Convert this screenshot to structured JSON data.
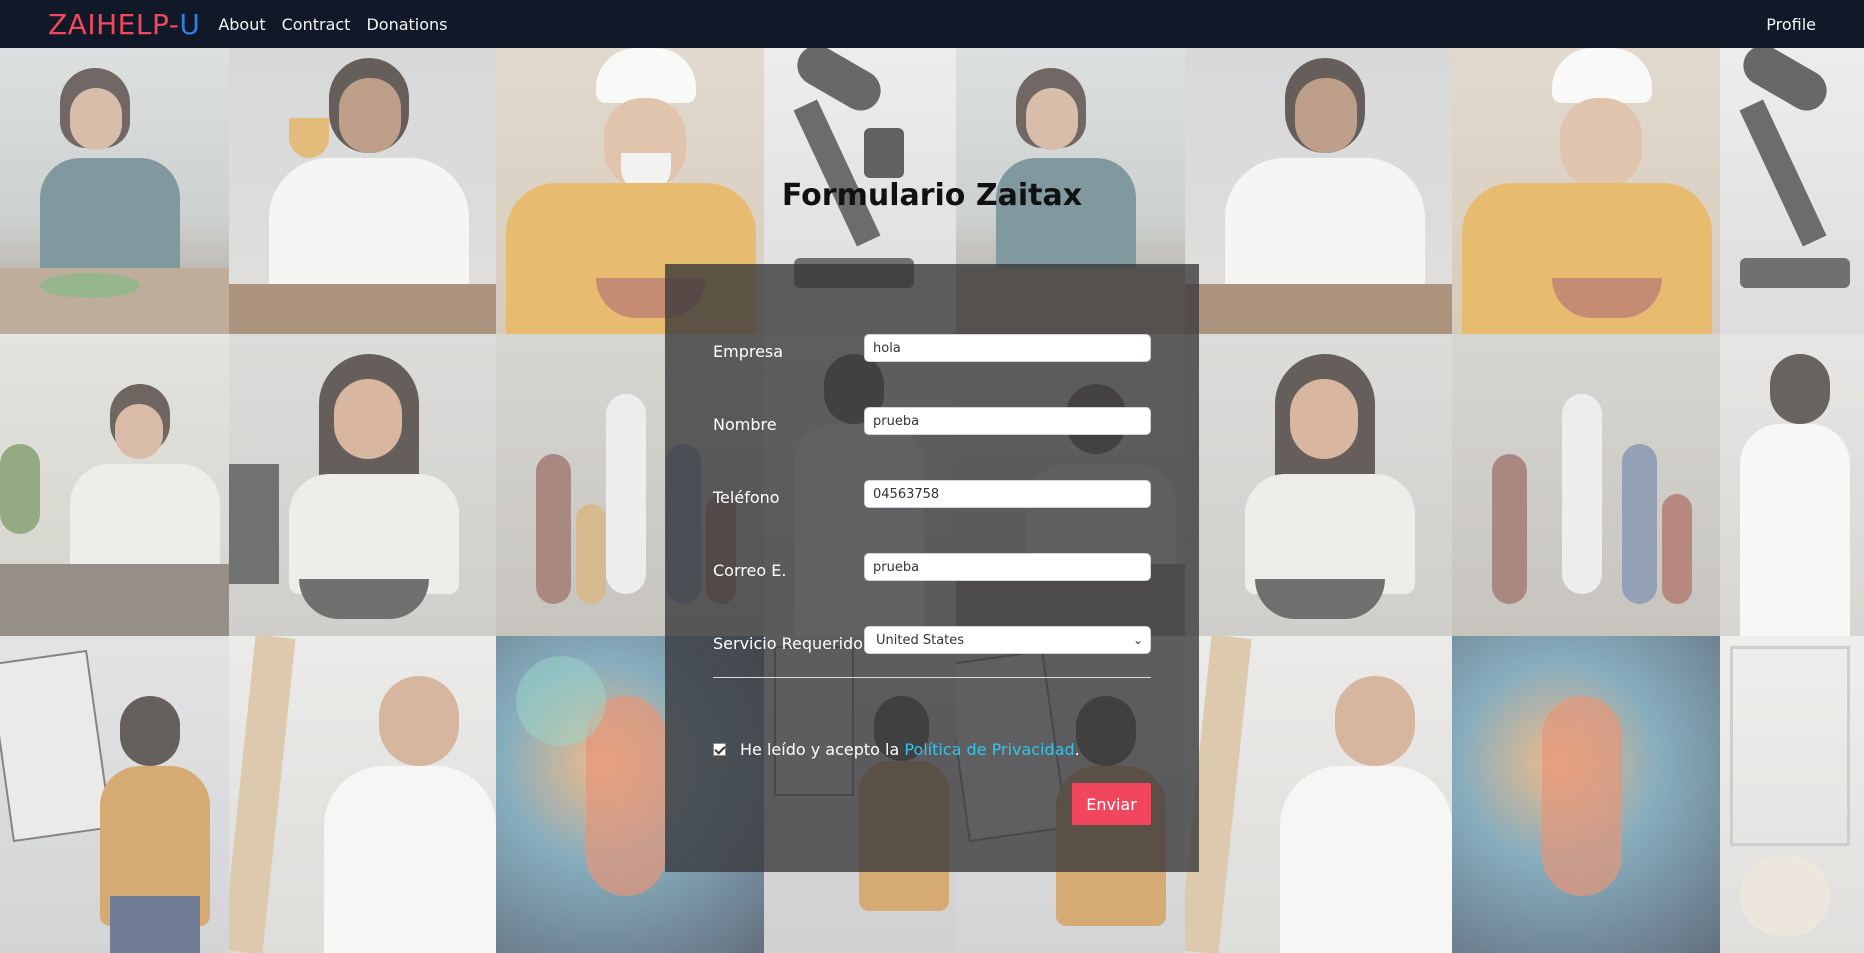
{
  "nav": {
    "brand_part1": "ZAIHELP-",
    "brand_part2": "U",
    "links": [
      "About",
      "Contract",
      "Donations"
    ],
    "profile": "Profile"
  },
  "form": {
    "title": "Formulario Zaitax",
    "fields": [
      {
        "label": "Empresa",
        "value": "hola"
      },
      {
        "label": "Nombre",
        "value": "prueba"
      },
      {
        "label": "Teléfono",
        "value": "04563758"
      },
      {
        "label": "Correo E.",
        "value": "prueba"
      }
    ],
    "service": {
      "label": "Servicio Requerido",
      "selected": "United States"
    },
    "consent": {
      "prefix": "He leído y acepto la ",
      "link": "Política de Privacidad",
      "suffix": "."
    },
    "submit": "Enviar"
  },
  "colors": {
    "navbar": "#111827",
    "brand_red": "#f0485f",
    "brand_blue": "#2f7fe8",
    "link": "#33c4ea",
    "submit": "#f0475f"
  }
}
